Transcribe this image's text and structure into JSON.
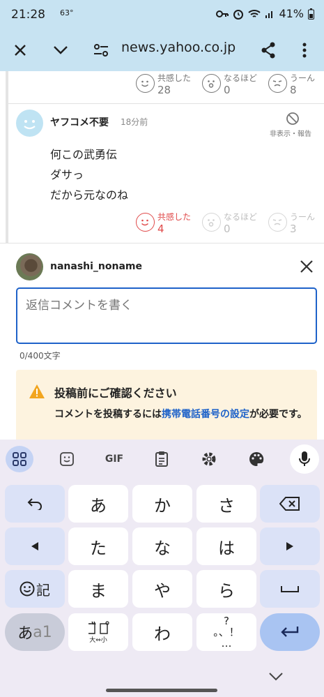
{
  "status_bar": {
    "time": "21:28",
    "temp": "63°",
    "battery": "41%"
  },
  "browser": {
    "url": "news.yahoo.co.jp"
  },
  "prev_comment": {
    "reactions": [
      {
        "label": "共感した",
        "count": "28"
      },
      {
        "label": "なるほど",
        "count": "0"
      },
      {
        "label": "うーん",
        "count": "8"
      }
    ]
  },
  "comment": {
    "username": "ヤフコメ不要",
    "time_ago": "18分前",
    "hide_label": "非表示・報告",
    "lines": [
      "何この武勇伝",
      "ダサっ",
      "だから元なのね"
    ],
    "reactions": [
      {
        "label": "共感した",
        "count": "4"
      },
      {
        "label": "なるほど",
        "count": "0"
      },
      {
        "label": "うーん",
        "count": "3"
      }
    ]
  },
  "reply": {
    "username": "nanashi_noname",
    "placeholder": "返信コメントを書く",
    "counter": "0/400文字"
  },
  "notice": {
    "title": "投稿前にご確認ください",
    "body_pre": "コメントを投稿するには",
    "body_link": "携帯電話番号の設定",
    "body_post": "が必要です。"
  },
  "keyboard": {
    "toolbar_icons": [
      "apps-icon",
      "sticker-icon",
      "gif-icon",
      "clipboard-icon",
      "settings-icon",
      "palette-icon",
      "mic-icon"
    ],
    "gif_label": "GIF",
    "keys": {
      "a": "あ",
      "ka": "か",
      "sa": "さ",
      "ta": "た",
      "na": "な",
      "ha": "は",
      "ma": "ま",
      "ya": "や",
      "ra": "ら",
      "wa": "わ",
      "emoji_label": "記",
      "mode_label_a": "あ",
      "mode_label_b": "a1",
      "dakuten_size": "大⇔小",
      "punct_top": "?",
      "punct_mid": "。、！",
      "punct_bottom": "…"
    }
  }
}
